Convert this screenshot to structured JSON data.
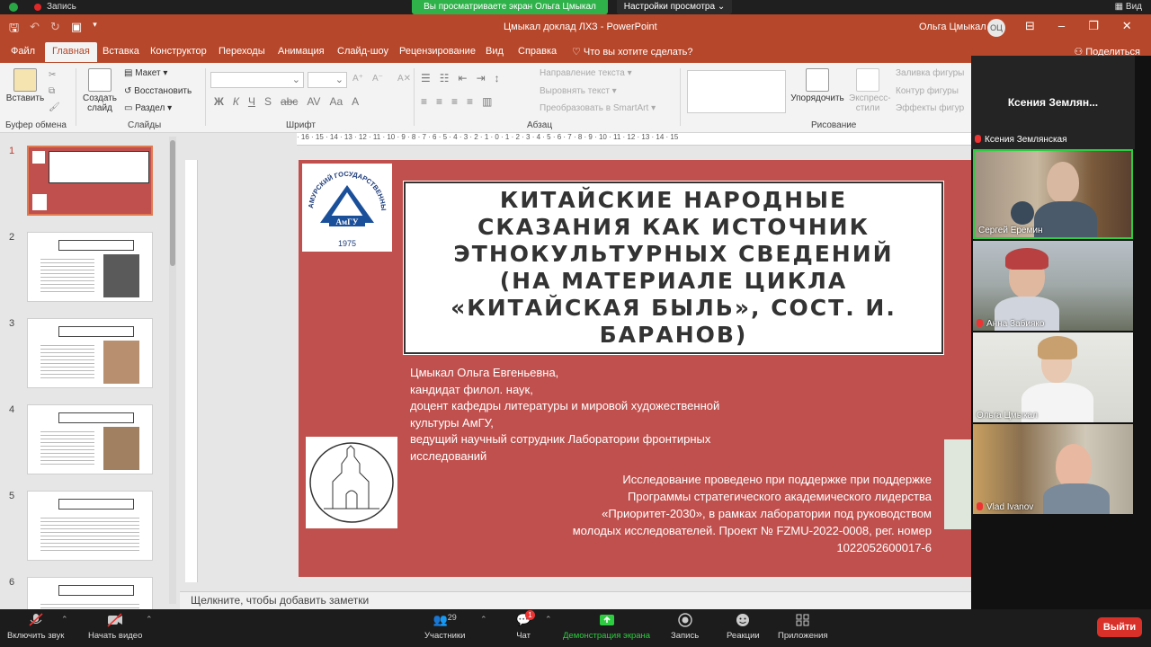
{
  "zoom": {
    "recording_label": "Запись",
    "share_banner": "Вы просматриваете экран Ольга Цмыкал",
    "view_options": "Настройки просмотра",
    "view_button": "Вид",
    "participants_count": "29",
    "chat_badge": "1",
    "toolbar": {
      "mute": "Включить звук",
      "video": "Начать видео",
      "participants": "Участники",
      "chat": "Чат",
      "share": "Демонстрация экрана",
      "record": "Запись",
      "reactions": "Реакции",
      "apps": "Приложения",
      "leave": "Выйти"
    },
    "colors": {
      "share_green": "#2fb24a",
      "leave_red": "#d9312a"
    }
  },
  "powerpoint": {
    "doc_title": "Цмыкал доклад ЛХЗ  -  PowerPoint",
    "user_name": "Ольга Цмыкал",
    "user_initials": "ОЦ",
    "tabs": [
      "Файл",
      "Главная",
      "Вставка",
      "Конструктор",
      "Переходы",
      "Анимация",
      "Слайд-шоу",
      "Рецензирование",
      "Вид",
      "Справка"
    ],
    "tell_me": "Что вы хотите сделать?",
    "share_label": "Поделиться",
    "ribbon": {
      "paste": "Вставить",
      "clipboard_group": "Буфер обмена",
      "new_slide": "Создать слайд",
      "layout": "Макет",
      "reset": "Восстановить",
      "section": "Раздел",
      "slides_group": "Слайды",
      "font_group": "Шрифт",
      "text_direction": "Направление текста",
      "align_text": "Выровнять текст",
      "smartart": "Преобразовать в SmartArt",
      "paragraph_group": "Абзац",
      "arrange": "Упорядочить",
      "quick_styles": "Экспресс-стили",
      "drawing_group": "Рисование",
      "shape_fill": "Заливка фигуры",
      "shape_outline": "Контур фигуры",
      "shape_effects": "Эффекты фигур"
    },
    "accent_color": "#b7472a",
    "thumbnails": [
      {
        "num": "1",
        "title": "КИТАЙСКИЕ НАРОДНЫЕ СКАЗАНИЯ КАК ИСТОЧНИК ЭТНОКУЛЬТУРНЫХ СВЕДЕНИЙ (НА МАТЕРИАЛЕ ЦИКЛА «КИТАЙСКАЯ БЫЛЬ», СОСТ. И. БАРАНОВ)"
      },
      {
        "num": "2",
        "title": "БАРАНОВ ИППОЛИТ ГАВРИЛОВИЧ"
      },
      {
        "num": "3",
        "title": "ЖУРНАЛ «ВЕСТНИК АЗИИ»"
      },
      {
        "num": "4",
        "title": "ЦИКЛ «КИТАЙСКАЯ БЫЛЬ»"
      },
      {
        "num": "5",
        "title": "И. БАРАНОВ, «КИТАЙСКАЯ БЫЛЬ»"
      },
      {
        "num": "6",
        "title": "И. БАРАНОВ, «КИТАЙСКАЯ БЫЛЬ»"
      }
    ],
    "notes_placeholder": "Щелкните, чтобы добавить заметки"
  },
  "slide": {
    "title": "КИТАЙСКИЕ НАРОДНЫЕ СКАЗАНИЯ КАК ИСТОЧНИК ЭТНОКУЛЬТУРНЫХ СВЕДЕНИЙ (НА МАТЕРИАЛЕ ЦИКЛА «КИТАЙСКАЯ БЫЛЬ», СОСТ. И. БАРАНОВ)",
    "author_lines": [
      "Цмыкал Ольга Евгеньевна,",
      "кандидат филол. наук,",
      "доцент кафедры литературы и мировой художественной",
      "культуры АмГУ,",
      "ведущий научный сотрудник Лаборатории фронтирных",
      "исследований"
    ],
    "funding": "Исследование проведено при поддержке при поддержке Программы стратегического академического лидерства «Приоритет-2030», в рамках лаборатории под руководством молодых исследователей. Проект № FZMU-2022-0008, рег. номер 1022052600017-6",
    "logo_university": "АМУРСКИЙ ГОСУДАРСТВЕННЫЙ УНИВЕРСИТЕТ",
    "logo_abbr": "АмГУ",
    "logo_year": "1975",
    "background": "#c0504d"
  },
  "gallery": {
    "active_speaker": "Ксения  Землян...",
    "active_speaker_full": "Ксения Землянская",
    "tiles": [
      {
        "name": "Сергей Еремин",
        "muted": false
      },
      {
        "name": "Анна Забияко",
        "muted": true
      },
      {
        "name": "Ольга Цмыкал",
        "muted": false
      },
      {
        "name": "Vlad Ivanov",
        "muted": true
      }
    ]
  }
}
